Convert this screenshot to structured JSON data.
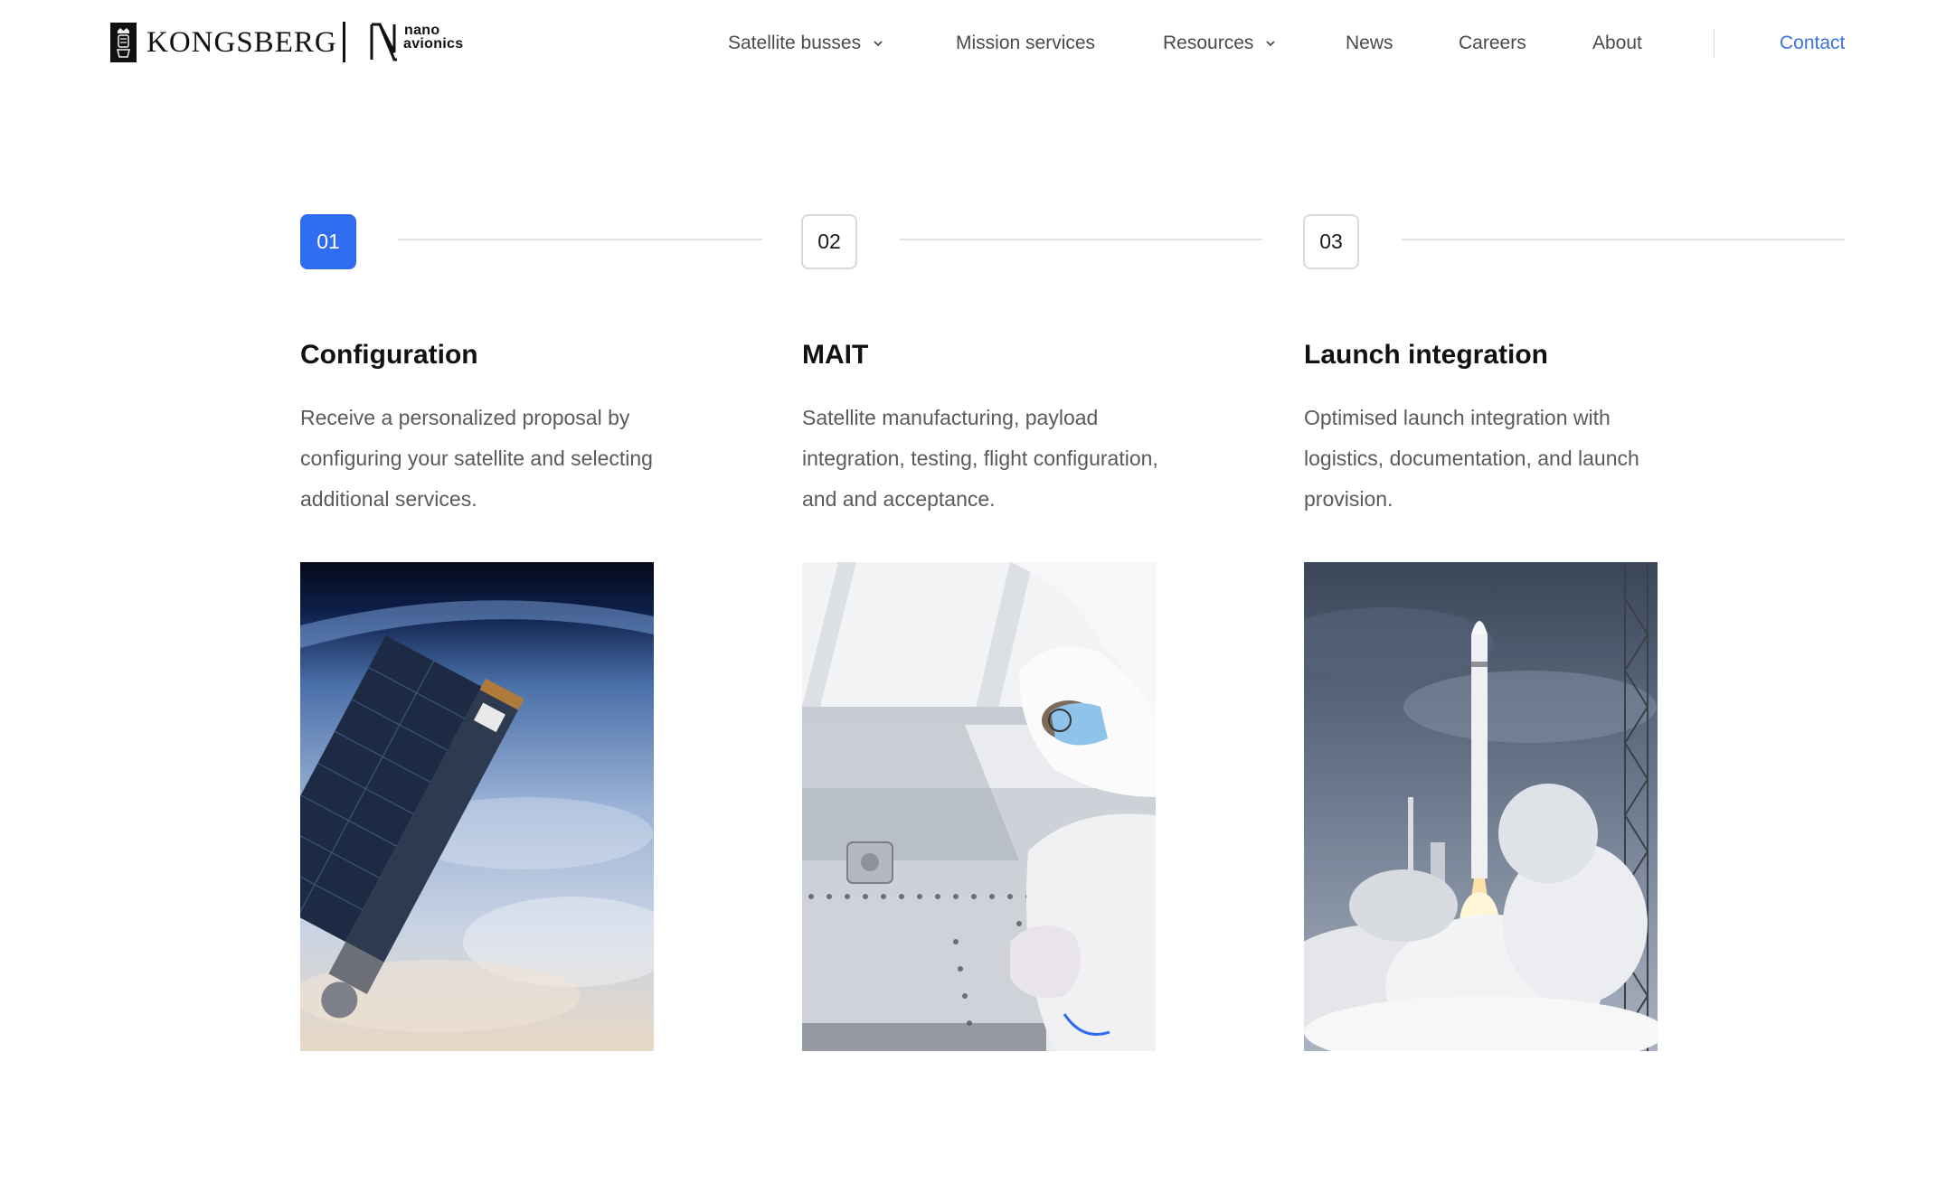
{
  "header": {
    "brand_primary": "KONGSBERG",
    "brand_secondary_line1": "nano",
    "brand_secondary_line2": "avionics",
    "nav": [
      {
        "label": "Satellite busses",
        "has_dropdown": true
      },
      {
        "label": "Mission services",
        "has_dropdown": false
      },
      {
        "label": "Resources",
        "has_dropdown": true
      },
      {
        "label": "News",
        "has_dropdown": false
      },
      {
        "label": "Careers",
        "has_dropdown": false
      },
      {
        "label": "About",
        "has_dropdown": false
      }
    ],
    "contact_label": "Contact"
  },
  "steps": [
    {
      "number": "01",
      "active": true,
      "title": "Configuration",
      "description": "Receive a personalized proposal by configuring your satellite and selecting additional services.",
      "image_icon": "satellite-orbit-image"
    },
    {
      "number": "02",
      "active": false,
      "title": "MAIT",
      "description": "Satellite manufacturing, payload integration, testing, flight configuration, and and acceptance.",
      "image_icon": "cleanroom-engineer-image"
    },
    {
      "number": "03",
      "active": false,
      "title": "Launch integration",
      "description": "Optimised launch integration with logistics, documentation, and launch provision.",
      "image_icon": "rocket-launch-image"
    }
  ],
  "colors": {
    "accent": "#2f6cf0",
    "contact_link": "#3b72e0",
    "text_body": "#5a5a5a",
    "line": "#e2e2e2"
  }
}
